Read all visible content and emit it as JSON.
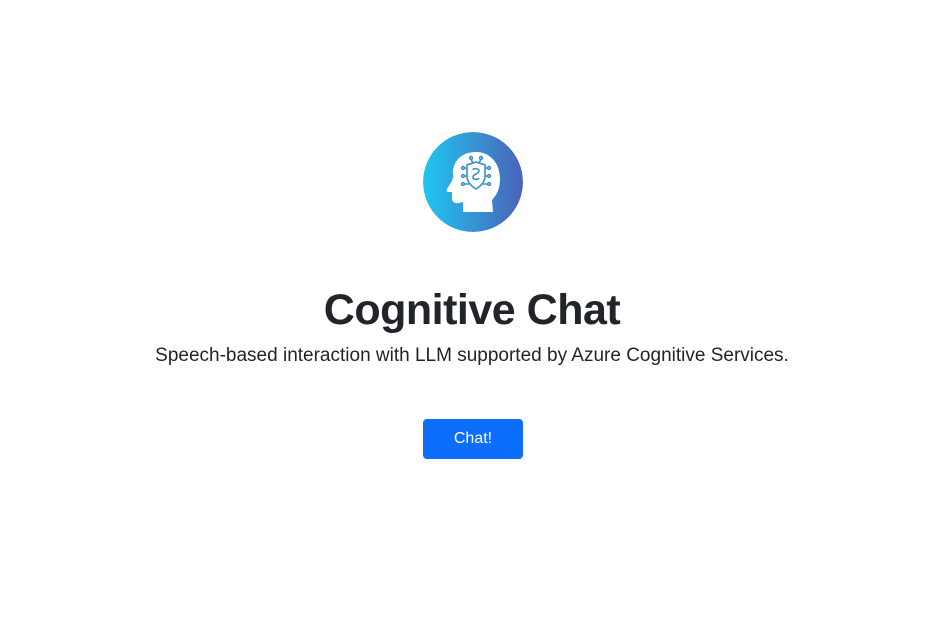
{
  "header": {
    "logo_icon": "ai-head-brain-icon",
    "title": "Cognitive Chat",
    "subtitle": "Speech-based interaction with LLM supported by Azure Cognitive Services."
  },
  "actions": {
    "chat_label": "Chat!"
  },
  "colors": {
    "primary_button": "#0d6efd",
    "logo_gradient_start": "#1fc6f0",
    "logo_gradient_end": "#4a62b8",
    "text": "#212529",
    "background": "#ffffff"
  }
}
